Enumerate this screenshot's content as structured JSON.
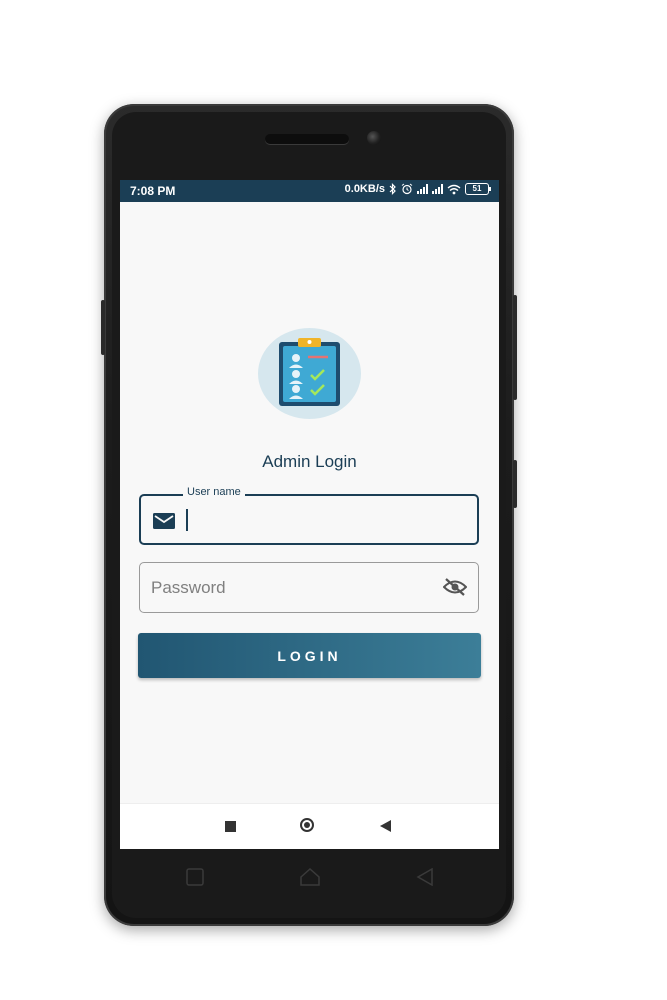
{
  "status_bar": {
    "time": "7:08 PM",
    "network_speed": "0.0KB/s",
    "battery": "51",
    "icons": [
      "bluetooth-icon",
      "alarm-icon",
      "signal-icon",
      "signal-icon",
      "wifi-icon",
      "battery-icon"
    ]
  },
  "app": {
    "title": "Admin Login",
    "logo_icon": "clipboard-checklist-icon"
  },
  "form": {
    "username": {
      "label": "User name",
      "value": "",
      "icon": "mail-icon"
    },
    "password": {
      "placeholder": "Password",
      "value": "",
      "toggle_icon": "eye-off-icon"
    },
    "login_button": "LOGIN"
  },
  "colors": {
    "primary": "#1b3e55",
    "button_start": "#215672",
    "button_end": "#3c7e98",
    "logo_bg": "#d6e7ee"
  }
}
